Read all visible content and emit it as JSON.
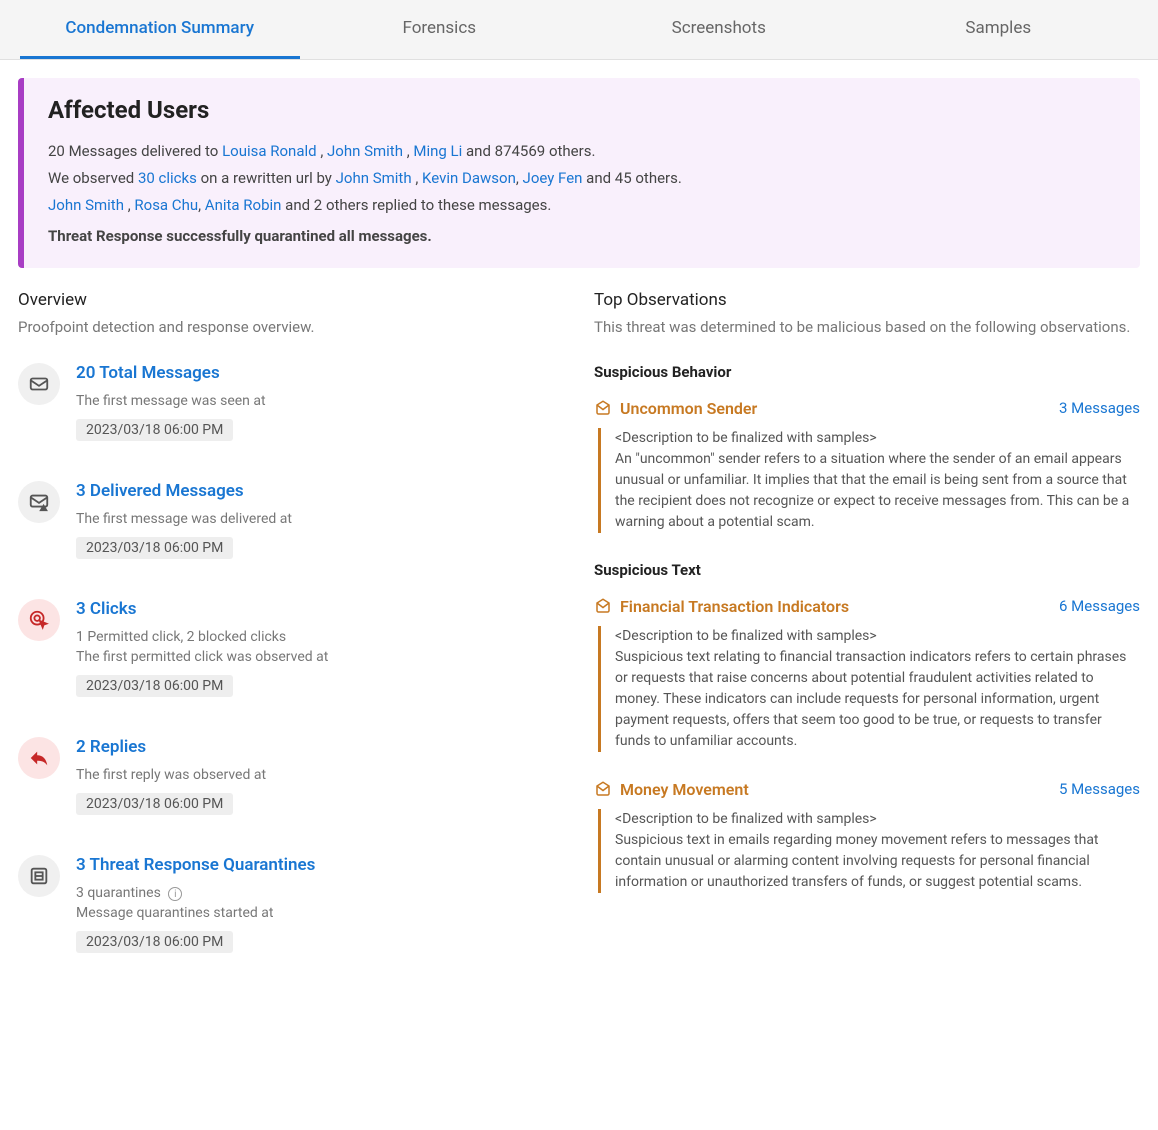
{
  "tabs": [
    {
      "label": "Condemnation Summary",
      "active": true
    },
    {
      "label": "Forensics",
      "active": false
    },
    {
      "label": "Screenshots",
      "active": false
    },
    {
      "label": "Samples",
      "active": false
    }
  ],
  "affected": {
    "title": "Affected Users",
    "line1_prefix": "20 Messages delivered to ",
    "line1_user1": "Louisa Ronald",
    "line1_sep1": " , ",
    "line1_user2": "John Smith",
    "line1_sep2": " , ",
    "line1_user3": "Ming Li",
    "line1_suffix": " and 874569 others.",
    "line2_prefix": "We observed ",
    "line2_clicks": "30 clicks",
    "line2_mid": " on a rewritten url by ",
    "line2_user1": "John Smith",
    "line2_sep1": " , ",
    "line2_user2": "Kevin Dawson",
    "line2_sep2": ", ",
    "line2_user3": "Joey Fen",
    "line2_suffix": " and 45 others.",
    "line3_user1": "John Smith",
    "line3_sep1": " , ",
    "line3_user2": "Rosa Chu",
    "line3_sep2": ", ",
    "line3_user3": "Anita Robin",
    "line3_suffix": " and 2 others replied to these messages.",
    "line4": "Threat Response successfully quarantined all messages."
  },
  "overview": {
    "title": "Overview",
    "subtitle": "Proofpoint detection and response overview.",
    "items": [
      {
        "heading": "20 Total Messages",
        "detail1": "The first message was seen at",
        "date": "2023/03/18 06:00 PM",
        "icon": "envelope-icon",
        "red": false
      },
      {
        "heading": "3 Delivered Messages",
        "detail1": "The first message was delivered at",
        "date": "2023/03/18 06:00 PM",
        "icon": "envelope-warning-icon",
        "red": false
      },
      {
        "heading": "3 Clicks",
        "detail0": "1 Permitted click, 2 blocked clicks",
        "detail1": "The first permitted click was observed at",
        "date": "2023/03/18 06:00 PM",
        "icon": "click-target-icon",
        "red": true
      },
      {
        "heading": "2 Replies",
        "detail1": "The first reply was observed at",
        "date": "2023/03/18 06:00 PM",
        "icon": "reply-icon",
        "red": true
      },
      {
        "heading": "3 Threat Response Quarantines",
        "detail0": "3 quarantines",
        "detail1": "Message quarantines started at",
        "date": "2023/03/18 06:00 PM",
        "icon": "quarantine-icon",
        "red": false,
        "info": true
      }
    ]
  },
  "observations": {
    "title": "Top Observations",
    "subtitle": "This threat was determined to be malicious based on the following observations.",
    "groups": [
      {
        "name": "Suspicious Behavior",
        "items": [
          {
            "title": "Uncommon Sender",
            "count": "3 Messages",
            "placeholder": "<Description to be finalized with samples>",
            "desc": "An \"uncommon\" sender refers to a situation where the sender of an email appears unusual or unfamiliar. It implies that that the email is being sent from a source that the recipient does not recognize or expect to receive messages from. This can be a warning about a potential scam."
          }
        ]
      },
      {
        "name": "Suspicious Text",
        "items": [
          {
            "title": "Financial Transaction Indicators",
            "count": "6 Messages",
            "placeholder": "<Description to be finalized with samples>",
            "desc": "Suspicious text relating to financial transaction indicators refers to certain phrases or requests that raise concerns about potential fraudulent activities related to money. These indicators can include requests for personal information, urgent payment requests, offers that seem too good to be true, or requests to transfer funds to unfamiliar accounts."
          },
          {
            "title": "Money Movement",
            "count": "5 Messages",
            "placeholder": "<Description to be finalized with samples>",
            "desc": "Suspicious text in emails regarding money movement refers to messages that contain unusual or alarming content involving requests for personal financial information or unauthorized transfers of funds, or suggest potential scams."
          }
        ]
      }
    ]
  }
}
